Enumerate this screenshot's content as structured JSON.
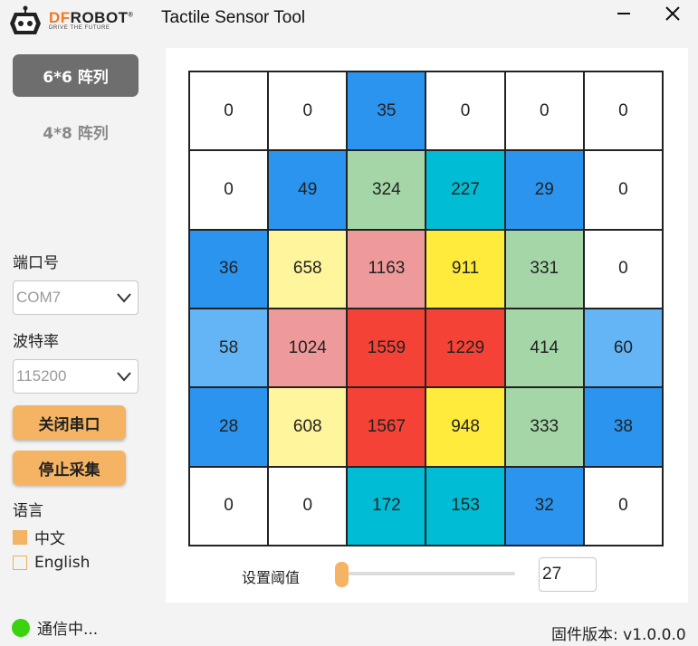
{
  "app": {
    "title": "Tactile Sensor Tool",
    "logo_brand_df": "DF",
    "logo_brand_rest": "ROBOT",
    "logo_tagline": "DRIVE THE FUTURE"
  },
  "sidebar": {
    "tabs": [
      {
        "label": "6*6 阵列",
        "active": true
      },
      {
        "label": "4*8 阵列",
        "active": false
      }
    ],
    "port_label": "端口号",
    "port_value": "COM7",
    "baud_label": "波特率",
    "baud_value": "115200",
    "close_port_label": "关闭串口",
    "stop_collect_label": "停止采集",
    "language_label": "语言",
    "languages": [
      {
        "label": "中文",
        "selected": true
      },
      {
        "label": "English",
        "selected": false
      }
    ],
    "status_text": "通信中...",
    "status_color": "#39d40d"
  },
  "grid": {
    "values": [
      [
        0,
        0,
        35,
        0,
        0,
        0
      ],
      [
        0,
        49,
        324,
        227,
        29,
        0
      ],
      [
        36,
        658,
        1163,
        911,
        331,
        0
      ],
      [
        58,
        1024,
        1559,
        1229,
        414,
        60
      ],
      [
        28,
        608,
        1567,
        948,
        333,
        38
      ],
      [
        0,
        0,
        172,
        153,
        32,
        0
      ]
    ],
    "colors": [
      [
        "#ffffff",
        "#ffffff",
        "#2a94ef",
        "#ffffff",
        "#ffffff",
        "#ffffff"
      ],
      [
        "#ffffff",
        "#2a94ef",
        "#a5d6a7",
        "#00bcd4",
        "#2a94ef",
        "#ffffff"
      ],
      [
        "#2a94ef",
        "#fff59d",
        "#ef9a9a",
        "#ffeb3b",
        "#a5d6a7",
        "#ffffff"
      ],
      [
        "#64b5f6",
        "#ef9a9a",
        "#f44336",
        "#f44336",
        "#a5d6a7",
        "#64b5f6"
      ],
      [
        "#2a94ef",
        "#fff59d",
        "#f44336",
        "#ffeb3b",
        "#a5d6a7",
        "#2a94ef"
      ],
      [
        "#ffffff",
        "#ffffff",
        "#00bcd4",
        "#00bcd4",
        "#2a94ef",
        "#ffffff"
      ]
    ]
  },
  "threshold": {
    "label": "设置阈值",
    "value": "27",
    "slider_fraction": 0.03,
    "accent": "#f5b463"
  },
  "footer": {
    "firmware": "固件版本: v1.0.0.0"
  }
}
